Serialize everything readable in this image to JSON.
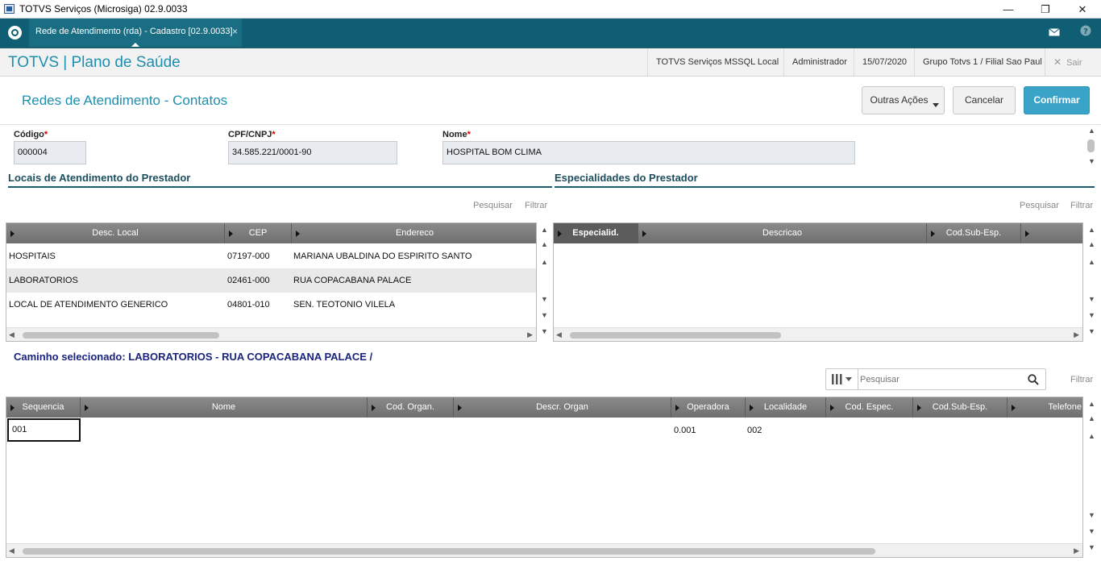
{
  "window": {
    "title": "TOTVS Serviços (Microsiga) 02.9.0033",
    "min": "—",
    "restore": "❐",
    "close": "✕"
  },
  "tabbar": {
    "tab_label": "Rede de Atendimento (rda) - Cadastro [02.9.0033]",
    "tab_close": "×",
    "mail_icon": "envelope-icon",
    "help_icon": "help-icon"
  },
  "header": {
    "brand": "TOTVS | Plano de Saúde",
    "environment": "TOTVS Serviços MSSQL Local",
    "user": "Administrador",
    "date": "15/07/2020",
    "branch": "Grupo Totvs 1 / Filial Sao Paul",
    "exit_icon": "✕",
    "exit_label": "Sair"
  },
  "page": {
    "heading": "Redes de Atendimento - Contatos",
    "other_actions": "Outras Ações",
    "cancel": "Cancelar",
    "confirm": "Confirmar"
  },
  "form": {
    "codigo": {
      "label": "Código",
      "value": "000004"
    },
    "cpf": {
      "label": "CPF/CNPJ",
      "value": "34.585.221/0001-90"
    },
    "nome": {
      "label": "Nome",
      "value": "HOSPITAL BOM CLIMA"
    },
    "required_mark": "*"
  },
  "locais": {
    "title": "Locais de Atendimento do Prestador",
    "search": "Pesquisar",
    "filter": "Filtrar",
    "columns": [
      "Desc. Local",
      "CEP",
      "Endereco"
    ],
    "rows": [
      [
        "HOSPITAIS",
        "07197-000",
        "MARIANA UBALDINA DO ESPIRITO SANTO"
      ],
      [
        "LABORATORIOS",
        "02461-000",
        "RUA COPACABANA PALACE"
      ],
      [
        "LOCAL DE ATENDIMENTO GENERICO",
        "04801-010",
        "SEN. TEOTONIO VILELA"
      ]
    ]
  },
  "especialidades": {
    "title": "Especialidades do Prestador",
    "search": "Pesquisar",
    "filter": "Filtrar",
    "columns": [
      "Especialid.",
      "Descricao",
      "Cod.Sub-Esp."
    ]
  },
  "caminho": "Caminho selecionado: LABORATORIOS - RUA COPACABANA PALACE /",
  "contatos": {
    "search_placeholder": "Pesquisar",
    "filter": "Filtrar",
    "columns": [
      "Sequencia",
      "Nome",
      "Cod. Organ.",
      "Descr. Organ",
      "Operadora",
      "Localidade",
      "Cod. Espec.",
      "Cod.Sub-Esp.",
      "Telefone"
    ],
    "rows": [
      [
        "001",
        "",
        "",
        "",
        "0.001",
        "002",
        "",
        "",
        ""
      ]
    ]
  },
  "colors": {
    "accent": "#1d8fb0",
    "tabbar": "#0f5e73",
    "confirm": "#3aa4c8",
    "path": "#1a237e"
  }
}
